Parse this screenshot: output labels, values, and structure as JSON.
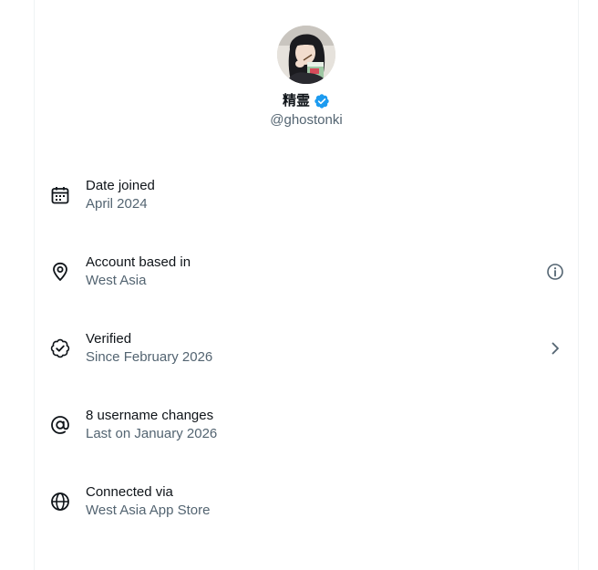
{
  "profile": {
    "display_name": "精霊",
    "handle": "@ghostonki",
    "avatar_icon": "profile-photo",
    "verified_icon": "verified-badge-icon",
    "verified_color": "#1d9bf0"
  },
  "about_rows": [
    {
      "title": "Date joined",
      "subtitle": "April 2024",
      "icon": "calendar-icon"
    },
    {
      "title": "Account based in",
      "subtitle": "West Asia",
      "icon": "location-pin-icon",
      "trailing_icon": "info-icon"
    },
    {
      "title": "Verified",
      "subtitle": "Since February 2026",
      "icon": "verified-check-icon",
      "trailing_icon": "chevron-right-icon"
    },
    {
      "title": "8 username changes",
      "subtitle": "Last on January 2026",
      "icon": "at-sign-icon"
    },
    {
      "title": "Connected via",
      "subtitle": "West Asia App Store",
      "icon": "globe-icon"
    }
  ],
  "colors": {
    "primary_text": "#0f1419",
    "secondary_text": "#536471",
    "border": "#eff3f4"
  }
}
